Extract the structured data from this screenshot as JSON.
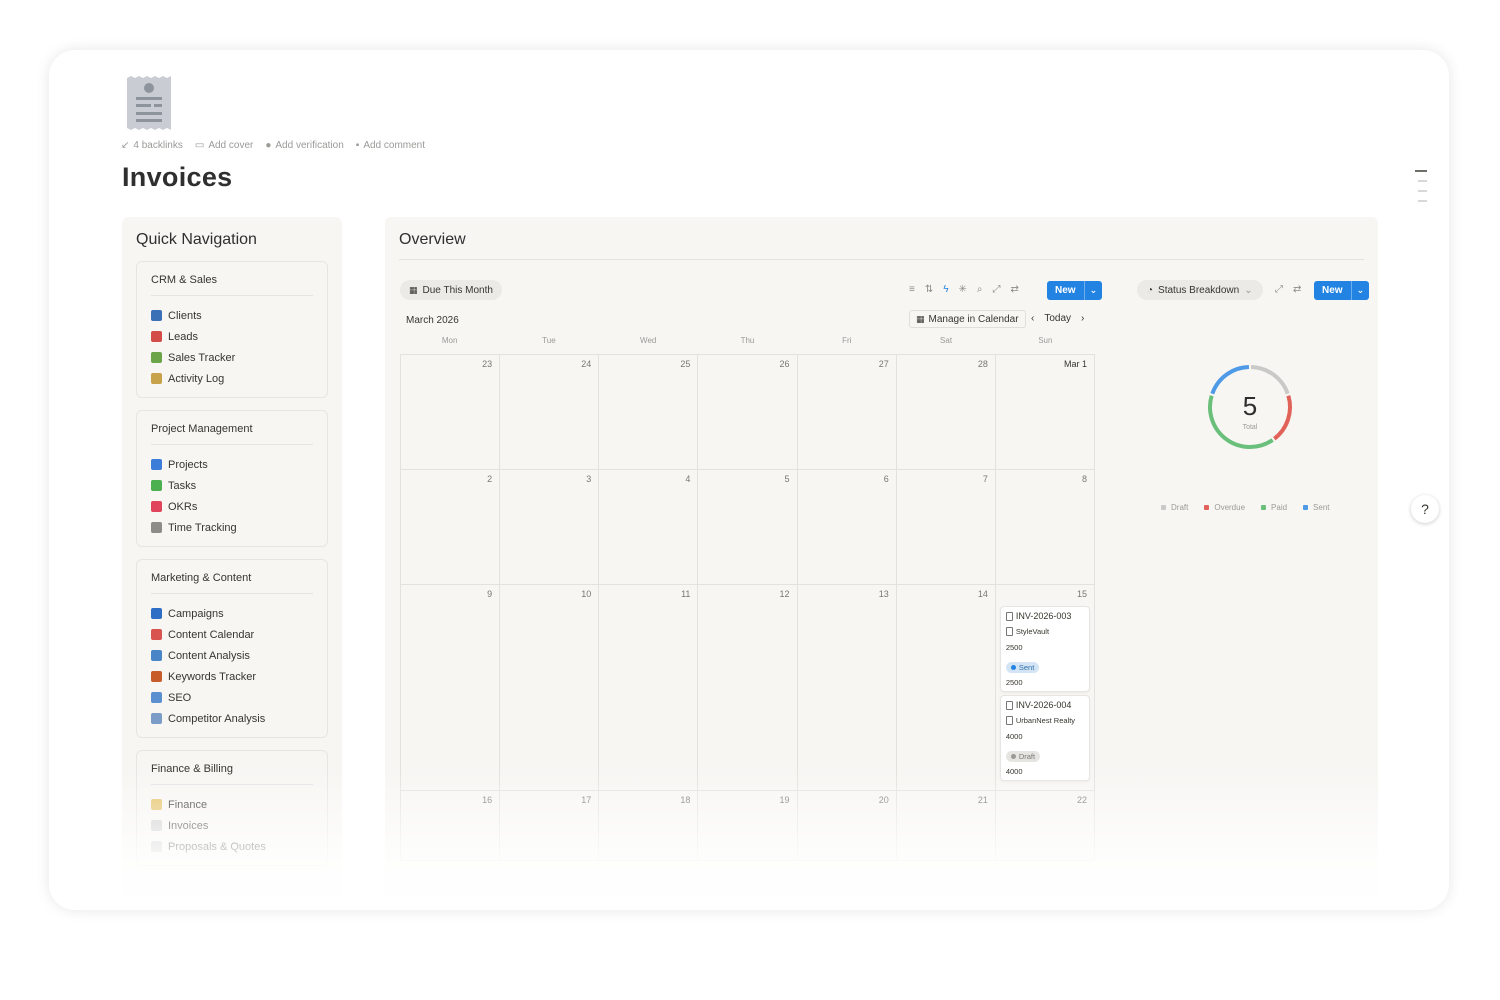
{
  "page": {
    "title": "Invoices",
    "meta": [
      "4 backlinks",
      "Add cover",
      "Add verification",
      "Add comment"
    ]
  },
  "nav": {
    "title": "Quick Navigation",
    "groups": [
      {
        "title": "CRM & Sales",
        "items": [
          {
            "label": "Clients",
            "color": "#3b6fb6"
          },
          {
            "label": "Leads",
            "color": "#d44c47"
          },
          {
            "label": "Sales Tracker",
            "color": "#6ca44a"
          },
          {
            "label": "Activity Log",
            "color": "#c8a24b"
          }
        ]
      },
      {
        "title": "Project Management",
        "items": [
          {
            "label": "Projects",
            "color": "#3b7dd8"
          },
          {
            "label": "Tasks",
            "color": "#4caf50"
          },
          {
            "label": "OKRs",
            "color": "#e0445c"
          },
          {
            "label": "Time Tracking",
            "color": "#8d8c88"
          }
        ]
      },
      {
        "title": "Marketing & Content",
        "items": [
          {
            "label": "Campaigns",
            "color": "#2f6ec5"
          },
          {
            "label": "Content Calendar",
            "color": "#d9534f"
          },
          {
            "label": "Content Analysis",
            "color": "#4a86c7"
          },
          {
            "label": "Keywords Tracker",
            "color": "#c75b2a"
          },
          {
            "label": "SEO",
            "color": "#5a8fd0"
          },
          {
            "label": "Competitor Analysis",
            "color": "#7a9cc6"
          }
        ]
      },
      {
        "title": "Finance & Billing",
        "items": [
          {
            "label": "Finance",
            "color": "#e5c36a"
          },
          {
            "label": "Invoices",
            "color": "#cfcfcf"
          },
          {
            "label": "Proposals & Quotes",
            "color": "#cfcfcf"
          }
        ]
      }
    ]
  },
  "overview": {
    "title": "Overview",
    "view_tab": "Due This Month",
    "new_label": "New",
    "month": "March 2026",
    "manage": "Manage in Calendar",
    "today": "Today",
    "weekdays": [
      "Mon",
      "Tue",
      "Wed",
      "Thu",
      "Fri",
      "Sat",
      "Sun"
    ],
    "weeks": [
      [
        "23",
        "24",
        "25",
        "26",
        "27",
        "28",
        "Mar 1"
      ],
      [
        "2",
        "3",
        "4",
        "5",
        "6",
        "7",
        "8"
      ],
      [
        "9",
        "10",
        "11",
        "12",
        "13",
        "14",
        "15"
      ],
      [
        "16",
        "17",
        "18",
        "19",
        "20",
        "21",
        "22"
      ]
    ],
    "cards": [
      {
        "id": "INV-2026-003",
        "client": "StyleVault",
        "amount": "2500",
        "status": "Sent",
        "total": "2500"
      },
      {
        "id": "INV-2026-004",
        "client": "UrbanNest Realty",
        "amount": "4000",
        "status": "Draft",
        "total": "4000"
      }
    ],
    "status_view": "Status Breakdown",
    "chart_center": "5",
    "chart_center_label": "Total"
  },
  "chart_data": {
    "type": "pie",
    "categories": [
      "Draft",
      "Overdue",
      "Paid",
      "Sent"
    ],
    "values": [
      1,
      1,
      2,
      1
    ],
    "colors": [
      "#c9c9c7",
      "#e16259",
      "#6abf7b",
      "#4e9ae6"
    ],
    "legend": "bottom"
  }
}
